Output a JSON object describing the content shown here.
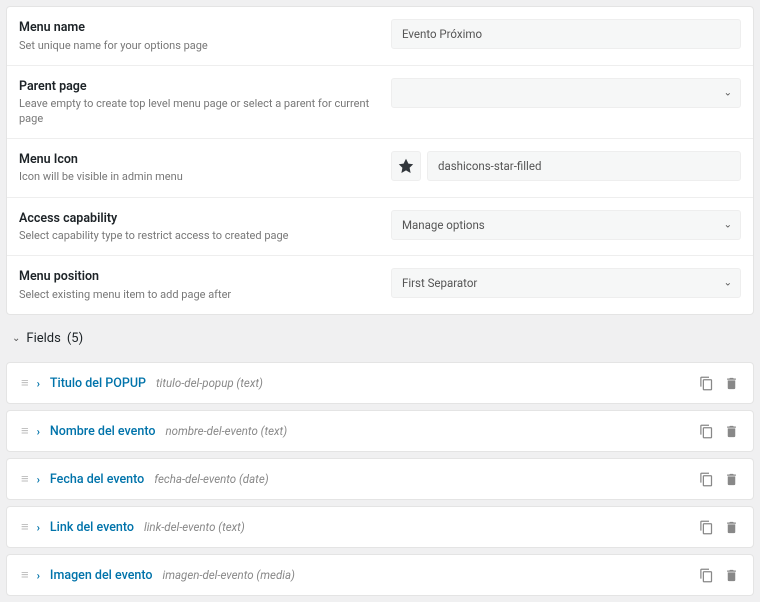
{
  "settings": {
    "menuName": {
      "label": "Menu name",
      "desc": "Set unique name for your options page",
      "value": "Evento Próximo"
    },
    "parentPage": {
      "label": "Parent page",
      "desc": "Leave empty to create top level menu page or select a parent for current page",
      "value": ""
    },
    "menuIcon": {
      "label": "Menu Icon",
      "desc": "Icon will be visible in admin menu",
      "value": "dashicons-star-filled"
    },
    "accessCap": {
      "label": "Access capability",
      "desc": "Select capability type to restrict access to created page",
      "value": "Manage options"
    },
    "menuPos": {
      "label": "Menu position",
      "desc": "Select existing menu item to add page after",
      "value": "First Separator"
    }
  },
  "fieldsSection": {
    "title": "Fields",
    "count": "(5)"
  },
  "fields": [
    {
      "title": "Titulo del POPUP",
      "slug": "titulo-del-popup",
      "type": "text"
    },
    {
      "title": "Nombre del evento",
      "slug": "nombre-del-evento",
      "type": "text"
    },
    {
      "title": "Fecha del evento",
      "slug": "fecha-del-evento",
      "type": "date"
    },
    {
      "title": "Link del evento",
      "slug": "link-del-evento",
      "type": "text"
    },
    {
      "title": "Imagen del evento",
      "slug": "imagen-del-evento",
      "type": "media"
    }
  ]
}
